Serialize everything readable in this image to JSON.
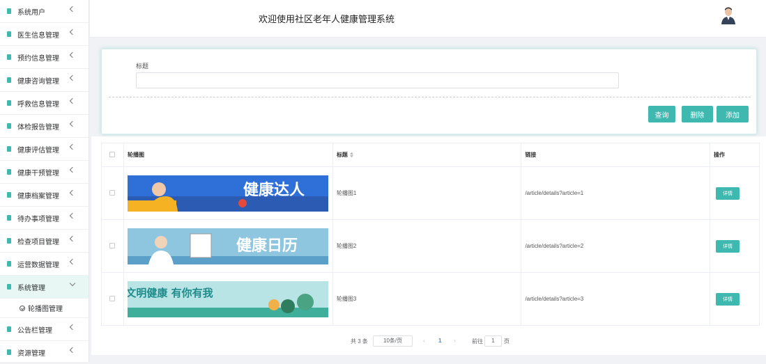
{
  "sidebar": {
    "items": [
      {
        "label": "系统用户"
      },
      {
        "label": "医生信息管理"
      },
      {
        "label": "预约信息管理"
      },
      {
        "label": "健康咨询管理"
      },
      {
        "label": "呼救信息管理"
      },
      {
        "label": "体检报告管理"
      },
      {
        "label": "健康评估管理"
      },
      {
        "label": "健康干预管理"
      },
      {
        "label": "健康档案管理"
      },
      {
        "label": "待办事项管理"
      },
      {
        "label": "检查项目管理"
      },
      {
        "label": "运营数据管理"
      },
      {
        "label": "系统管理",
        "open": true
      },
      {
        "label": "公告栏管理"
      },
      {
        "label": "资源管理"
      }
    ],
    "submenu": {
      "label": "轮播图管理"
    }
  },
  "header": {
    "title": "欢迎使用社区老年人健康管理系统"
  },
  "search": {
    "label": "标题",
    "value": "",
    "buttons": {
      "query": "查询",
      "delete": "删除",
      "add": "添加"
    }
  },
  "table": {
    "headers": {
      "image": "轮播图",
      "title": "标题",
      "link": "链接",
      "op": "操作"
    },
    "rows": [
      {
        "banner_text": "健康达人",
        "title": "轮播图1",
        "link": "/article/details?article=1",
        "action": "详情"
      },
      {
        "banner_text": "健康日历",
        "title": "轮播图2",
        "link": "/article/details?article=2",
        "action": "详情"
      },
      {
        "banner_text": "文明健康 有你有我",
        "title": "轮播图3",
        "link": "/article/details?article=3",
        "action": "详情"
      }
    ]
  },
  "pagination": {
    "total": "共 3 条",
    "page_size": "10条/页",
    "prev": "‹",
    "current": "1",
    "next": "›",
    "goto_label": "前往",
    "goto_value": "1",
    "suffix": "页"
  },
  "colors": {
    "accent": "#3fb8af"
  }
}
